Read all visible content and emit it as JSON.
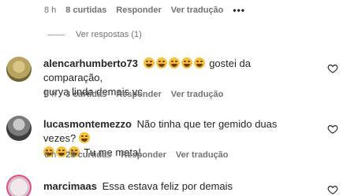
{
  "top_meta": {
    "time": "8 h",
    "likes": "8 curtidas",
    "reply": "Responder",
    "translate": "Ver tradução",
    "more": "•••"
  },
  "view_replies": "Ver respostas (1)",
  "comments": [
    {
      "username": "alencarhumberto73",
      "text_after_emojis": "gostei da comparação,",
      "text_line2": "gurya linda demais vc",
      "time": "5 h",
      "likes": "3 curtidas",
      "reply": "Responder",
      "translate": "Ver tradução"
    },
    {
      "username": "lucasmontemezzo",
      "text": "Não tinha que ter gemido duas vezes?",
      "text_after_emojis": "Tu me mata!",
      "time": "6 h",
      "likes": "25 curtidas",
      "reply": "Responder",
      "translate": "Ver tradução"
    },
    {
      "username": "marcimaas",
      "text": "Essa estava feliz por demais"
    }
  ],
  "icons": {
    "like": "heart-outline-icon",
    "emoji": "laughing-emoji"
  },
  "colors": {
    "meta_text": "#737373",
    "text": "#262626",
    "story_ring": "#e34b8a"
  }
}
